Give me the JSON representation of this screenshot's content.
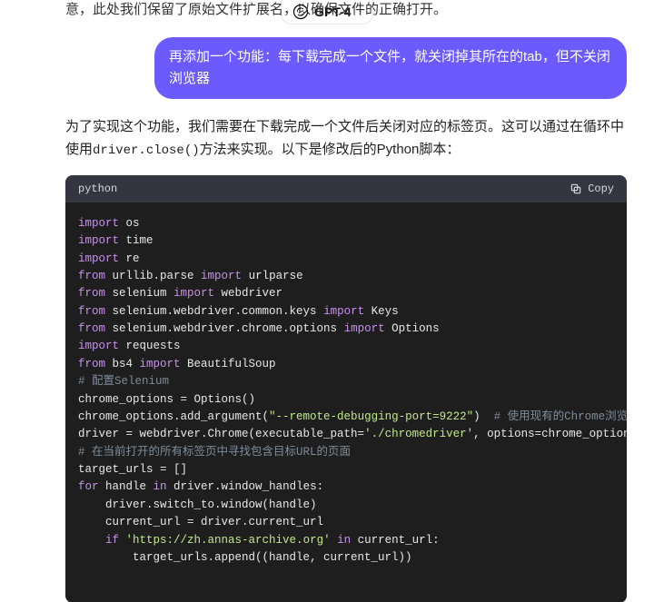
{
  "header": {
    "model_label": "GPT-4",
    "chevron": "›"
  },
  "conversation": {
    "assistant_fragment": "意，此处我们保留了原始文件扩展名，以确保文件的正确打开。",
    "user_message": "再添加一个功能：每下载完成一个文件，就关闭掉其所在的tab，但不关闭浏览器",
    "assistant_intro_prefix": "为了实现这个功能，我们需要在下载完成一个文件后关闭对应的标签页。这可以通过在循环中使用",
    "assistant_intro_code": "driver.close()",
    "assistant_intro_suffix": "方法来实现。以下是修改后的Python脚本："
  },
  "codeblock": {
    "lang": "python",
    "copy_label": "Copy",
    "lines": [
      [
        [
          "kw-import",
          "import "
        ],
        [
          "mod",
          "os"
        ]
      ],
      [
        [
          "kw-import",
          "import "
        ],
        [
          "mod",
          "time"
        ]
      ],
      [
        [
          "kw-import",
          "import "
        ],
        [
          "mod",
          "re"
        ]
      ],
      [
        [
          "kw-from",
          "from "
        ],
        [
          "mod",
          "urllib.parse "
        ],
        [
          "kw-import",
          "import "
        ],
        [
          "mod",
          "urlparse"
        ]
      ],
      [
        [
          "kw-from",
          "from "
        ],
        [
          "mod",
          "selenium "
        ],
        [
          "kw-import",
          "import "
        ],
        [
          "mod",
          "webdriver"
        ]
      ],
      [
        [
          "kw-from",
          "from "
        ],
        [
          "mod",
          "selenium.webdriver.common.keys "
        ],
        [
          "kw-import",
          "import "
        ],
        [
          "mod",
          "Keys"
        ]
      ],
      [
        [
          "kw-from",
          "from "
        ],
        [
          "mod",
          "selenium.webdriver.chrome.options "
        ],
        [
          "kw-import",
          "import "
        ],
        [
          "mod",
          "Options"
        ]
      ],
      [
        [
          "kw-import",
          "import "
        ],
        [
          "mod",
          "requests"
        ]
      ],
      [
        [
          "kw-from",
          "from "
        ],
        [
          "mod",
          "bs4 "
        ],
        [
          "kw-import",
          "import "
        ],
        [
          "mod",
          "BeautifulSoup"
        ]
      ],
      [
        [
          "blank",
          ""
        ]
      ],
      [
        [
          "cmt",
          "# 配置Selenium"
        ]
      ],
      [
        [
          "mod",
          "chrome_options = Options()"
        ]
      ],
      [
        [
          "mod",
          "chrome_options.add_argument("
        ],
        [
          "str",
          "\"--remote-debugging-port=9222\""
        ],
        [
          "mod",
          ")  "
        ],
        [
          "cmt",
          "# 使用现有的Chrome浏览器"
        ]
      ],
      [
        [
          "mod",
          "driver = webdriver.Chrome(executable_path="
        ],
        [
          "str",
          "'./chromedriver'"
        ],
        [
          "mod",
          ", options=chrome_options)"
        ]
      ],
      [
        [
          "blank",
          ""
        ]
      ],
      [
        [
          "cmt",
          "# 在当前打开的所有标签页中寻找包含目标URL的页面"
        ]
      ],
      [
        [
          "mod",
          "target_urls = []"
        ]
      ],
      [
        [
          "for",
          "for "
        ],
        [
          "mod",
          "handle "
        ],
        [
          "in",
          "in "
        ],
        [
          "mod",
          "driver.window_handles:"
        ]
      ],
      [
        [
          "mod",
          "    driver.switch_to.window(handle)"
        ]
      ],
      [
        [
          "mod",
          "    current_url = driver.current_url"
        ]
      ],
      [
        [
          "mod",
          "    "
        ],
        [
          "if",
          "if "
        ],
        [
          "str",
          "'https://zh.annas-archive.org'"
        ],
        [
          "mod",
          " "
        ],
        [
          "in",
          "in "
        ],
        [
          "mod",
          "current_url:"
        ]
      ],
      [
        [
          "mod",
          "        target_urls.append((handle, current_url))"
        ]
      ]
    ]
  }
}
